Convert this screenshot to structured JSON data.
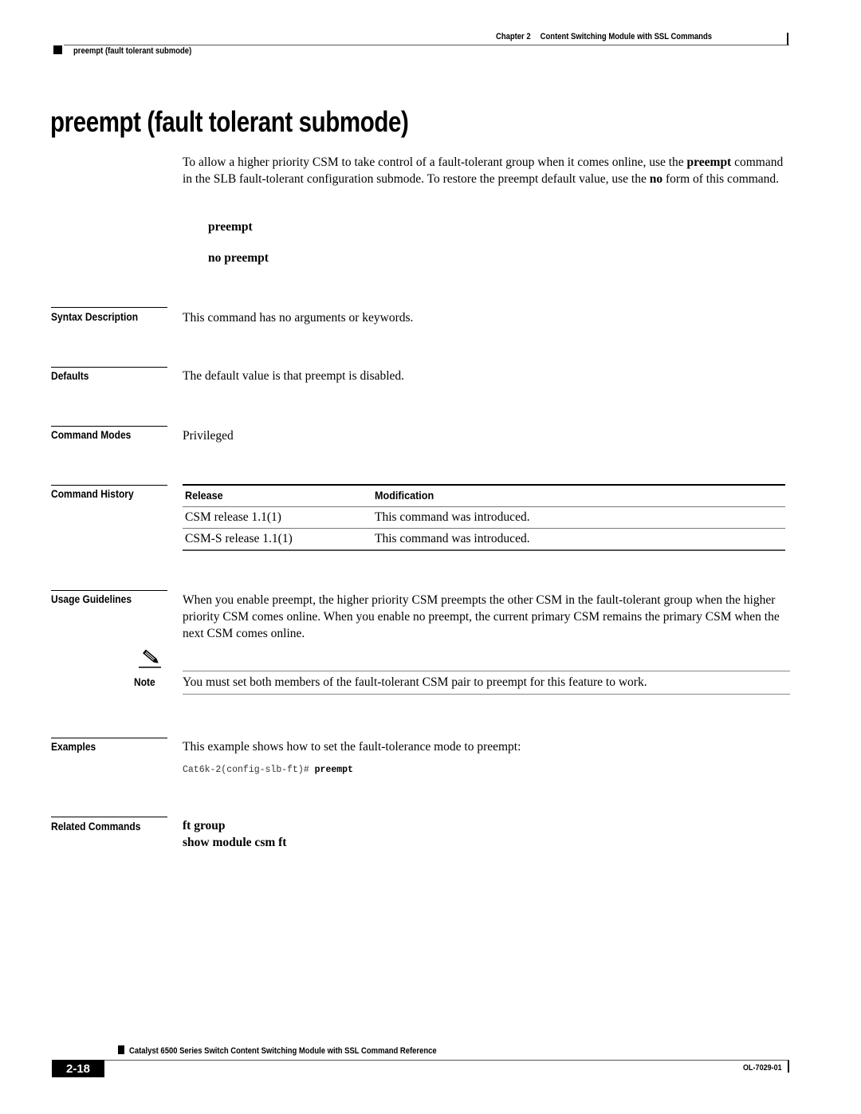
{
  "header": {
    "chapter_label": "Chapter 2",
    "chapter_title": "Content Switching Module with SSL Commands",
    "section": "preempt (fault tolerant submode)"
  },
  "title": "preempt (fault tolerant submode)",
  "intro": {
    "part1": "To allow a higher priority CSM to take control of a fault-tolerant group when it comes online, use the ",
    "bold1": "preempt",
    "part2": " command in the SLB fault-tolerant configuration submode. To restore the preempt default value, use the ",
    "bold2": "no",
    "part3": " form of this command."
  },
  "syntax": [
    "preempt",
    "no preempt"
  ],
  "sections": {
    "syntax_description": {
      "heading": "Syntax Description",
      "text": "This command has no arguments or keywords."
    },
    "defaults": {
      "heading": "Defaults",
      "text": "The default value is that preempt is disabled."
    },
    "command_modes": {
      "heading": "Command Modes",
      "text": "Privileged"
    },
    "command_history": {
      "heading": "Command History",
      "columns": [
        "Release",
        "Modification"
      ],
      "rows": [
        [
          "CSM release 1.1(1)",
          "This command was introduced."
        ],
        [
          "CSM-S release 1.1(1)",
          "This command was introduced."
        ]
      ]
    },
    "usage_guidelines": {
      "heading": "Usage Guidelines",
      "text": "When you enable preempt, the higher priority CSM preempts the other CSM in the fault-tolerant group when the higher priority CSM comes online. When you enable no preempt, the current primary CSM remains the primary CSM when the next CSM comes online."
    },
    "note": {
      "label": "Note",
      "icon": "pencil-icon",
      "text": "You must set both members of the fault-tolerant CSM pair to preempt for this feature to work."
    },
    "examples": {
      "heading": "Examples",
      "text": "This example shows how to set the fault-tolerance mode to preempt:",
      "code_prompt": "Cat6k-2(config-slb-ft)# ",
      "code_command": "preempt"
    },
    "related_commands": {
      "heading": "Related Commands",
      "items": [
        "ft group",
        "show module csm ft"
      ]
    }
  },
  "footer": {
    "book_title": "Catalyst 6500 Series Switch Content Switching Module with SSL Command Reference",
    "page_number": "2-18",
    "doc_id": "OL-7029-01"
  }
}
